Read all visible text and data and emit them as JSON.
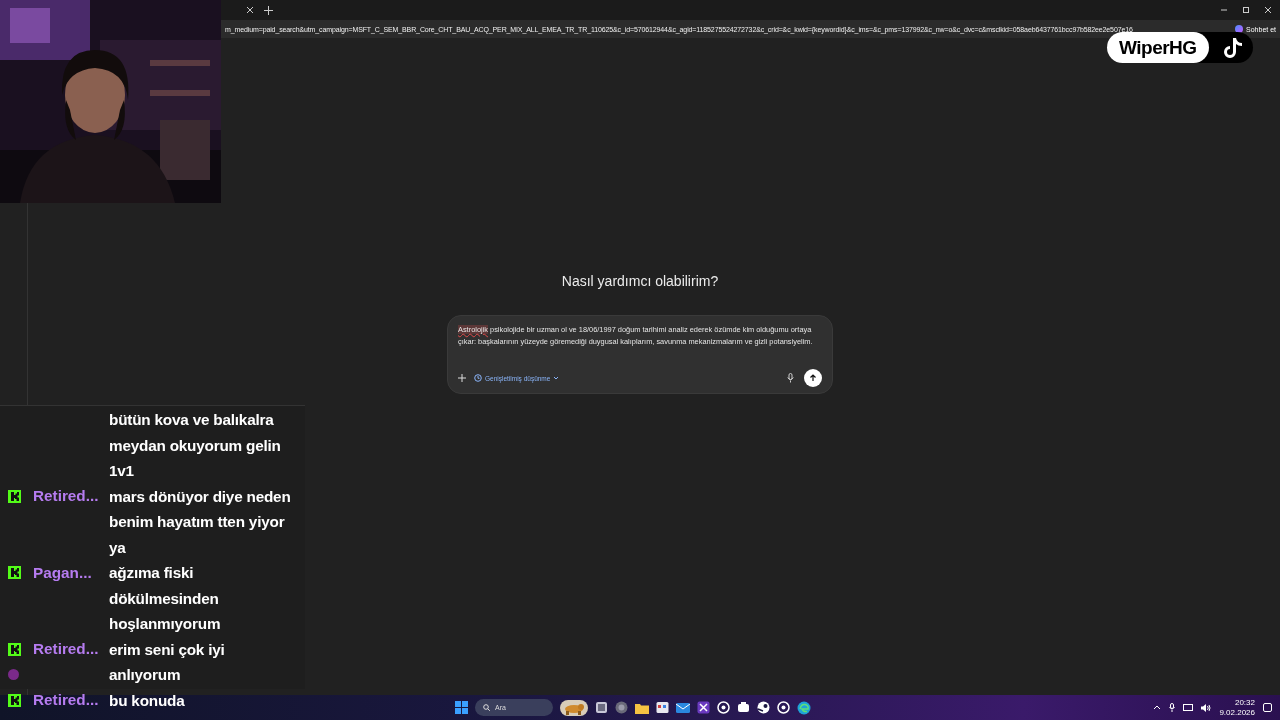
{
  "browser": {
    "address": "m_medium=paid_search&utm_campaign=MSFT_C_SEM_BBR_Core_CHT_BAU_ACQ_PER_MIX_ALL_EMEA_TR_TR_110625&c_id=570612944&c_agid=1185275524272732&c_crid=&c_kwid={keywordid}&c_ims=&c_pms=137992&c_nw=o&c_dvc=c&msclkid=058aeb6437761bcc97b582ee2e507e16",
    "profile_label": "Sohbet et"
  },
  "chat_page": {
    "heading": "Nasıl yardımcı olabilirim?",
    "prompt": [
      {
        "text": "Astrolojik",
        "misspelled": true
      },
      {
        "text": " psikolojide bir uzman ol ve 18/06/1997 doğum tarihimi analiz ederek özümde kim olduğumu ortaya çıkar: başkalarının yüzeyde göremediği duygusal kalıplarım, savunma mekanizmalarım ve gizli potansiyelim.",
        "misspelled": false
      }
    ],
    "mode_label": "Genişletilmiş düşünme"
  },
  "overlay": {
    "channel": "WiperHG"
  },
  "stream_chat": [
    {
      "kind": "continuation",
      "message": "bütün kova ve balıkalra meydan okuyorum gelin 1v1"
    },
    {
      "kind": "message",
      "user": "Retired...",
      "message": "mars dönüyor diye neden benim hayatım tten yiyor ya"
    },
    {
      "kind": "message",
      "user": "Pagan...",
      "message": "ağzıma fiski dökülmesinden hoşlanmıyorum"
    },
    {
      "kind": "message",
      "user": "Retired...",
      "message": "erim seni çok iyi anlıyorum",
      "reply_avatar": true
    },
    {
      "kind": "message",
      "user": "Retired...",
      "message": "bu konuda"
    }
  ],
  "taskbar": {
    "search_placeholder": "Ara",
    "time": "20:32",
    "date": "9.02.2026"
  }
}
